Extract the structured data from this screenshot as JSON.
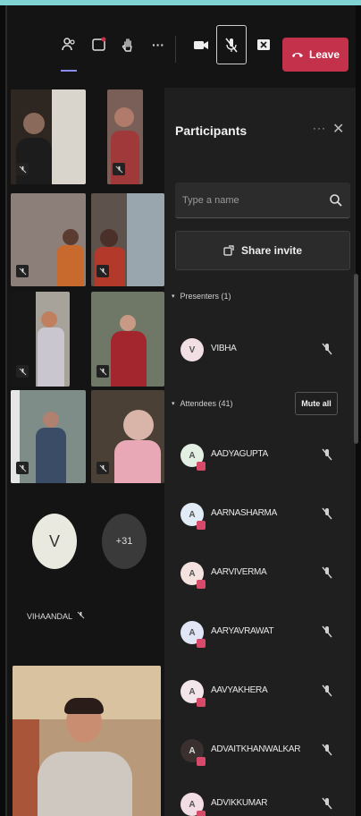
{
  "toolbar": {
    "leave_label": "Leave",
    "buttons": [
      "participants-icon",
      "chat-icon",
      "raise-hand-icon",
      "more-icon",
      "camera-icon",
      "mic-off-icon",
      "share-screen-icon"
    ],
    "more_label": "···"
  },
  "grid": {
    "tiles": [
      {
        "id": "tile-1",
        "color": "#3b2f2a"
      },
      {
        "id": "tile-2",
        "color": "#6d5a54"
      },
      {
        "id": "tile-3",
        "color": "#7a6b63"
      },
      {
        "id": "tile-4",
        "color": "#5a4c46"
      },
      {
        "id": "tile-5",
        "color": "#8a8a85"
      },
      {
        "id": "tile-6",
        "color": "#6f6b5a"
      },
      {
        "id": "tile-7",
        "color": "#7d8a86"
      },
      {
        "id": "tile-8",
        "color": "#6a625d"
      }
    ],
    "named_tile": {
      "initial": "V",
      "name": "VIHAANDAL"
    },
    "overflow_badge": "+31"
  },
  "panel": {
    "title": "Participants",
    "more": "···",
    "close": "✕",
    "search_placeholder": "Type a name",
    "share_label": "Share invite",
    "presenters_label": "Presenters (1)",
    "attendees_label": "Attendees (41)",
    "mute_all_label": "Mute all",
    "presenters": [
      {
        "name": "VIBHA",
        "initial": "V",
        "color": "#f2dfe4"
      }
    ],
    "attendees": [
      {
        "name": "AADYAGUPTA",
        "initial": "A",
        "color": "#e4efe4"
      },
      {
        "name": "AARNASHARMA",
        "initial": "A",
        "color": "#e1ecf6"
      },
      {
        "name": "AARVIVERMA",
        "initial": "A",
        "color": "#f4e2df"
      },
      {
        "name": "AARYAVRAWAT",
        "initial": "A",
        "color": "#e1e6f6"
      },
      {
        "name": "AAVYAKHERA",
        "initial": "A",
        "color": "#f2e6ea"
      },
      {
        "name": "ADVAITKHANWALKAR",
        "initial": "A",
        "color": "#3a3030"
      },
      {
        "name": "ADVIKKUMAR",
        "initial": "A",
        "color": "#f1dde3"
      }
    ]
  }
}
